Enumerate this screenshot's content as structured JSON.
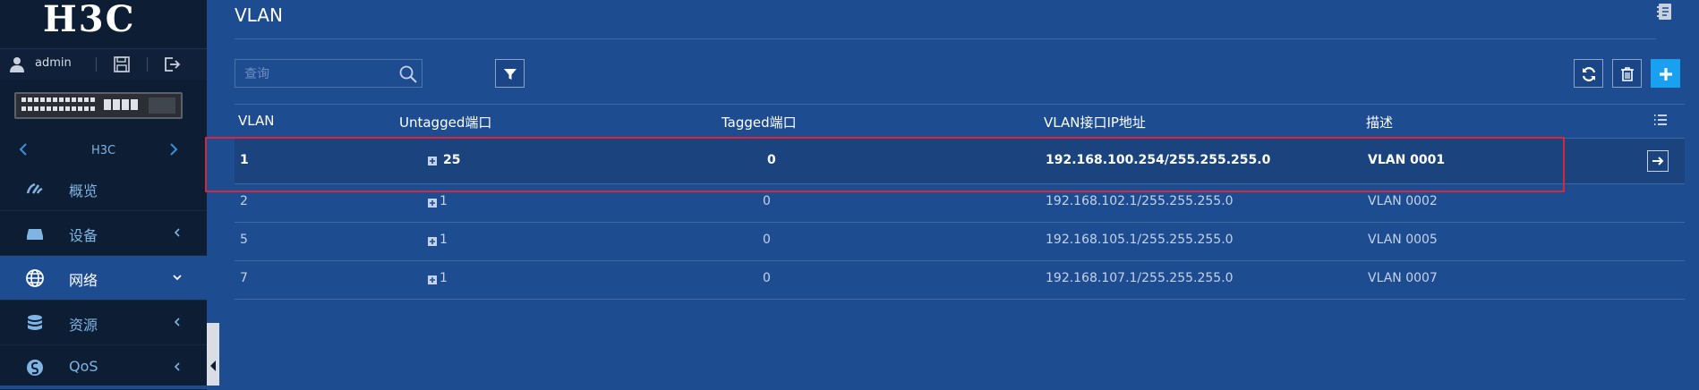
{
  "brand": {
    "logo_text": "H3C"
  },
  "user": {
    "name": "admin"
  },
  "device": {
    "name": "H3C"
  },
  "menu": [
    {
      "label": "概览",
      "icon": "dashboard-icon"
    },
    {
      "label": "设备",
      "icon": "device-icon"
    },
    {
      "label": "网络",
      "icon": "globe-icon"
    },
    {
      "label": "资源",
      "icon": "database-icon"
    },
    {
      "label": "QoS",
      "icon": "qos-icon"
    }
  ],
  "page": {
    "title": "VLAN"
  },
  "search": {
    "placeholder": "查询"
  },
  "table": {
    "headers": [
      "VLAN",
      "Untagged端口",
      "Tagged端口",
      "VLAN接口IP地址",
      "描述"
    ],
    "rows": [
      {
        "vlan": "1",
        "untagged": "25",
        "tagged": "0",
        "ip": "192.168.100.254/255.255.255.0",
        "desc": "VLAN 0001"
      },
      {
        "vlan": "2",
        "untagged": "1",
        "tagged": "0",
        "ip": "192.168.102.1/255.255.255.0",
        "desc": "VLAN 0002"
      },
      {
        "vlan": "5",
        "untagged": "1",
        "tagged": "0",
        "ip": "192.168.105.1/255.255.255.0",
        "desc": "VLAN 0005"
      },
      {
        "vlan": "7",
        "untagged": "1",
        "tagged": "0",
        "ip": "192.168.107.1/255.255.255.0",
        "desc": "VLAN 0007"
      }
    ]
  },
  "colors": {
    "sidebar_bg": "#0d1d33",
    "main_bg": "#1e4c91",
    "accent_blue": "#1aa0f0",
    "highlight_red": "#d8263a",
    "menu_text": "#7fb4e3"
  }
}
